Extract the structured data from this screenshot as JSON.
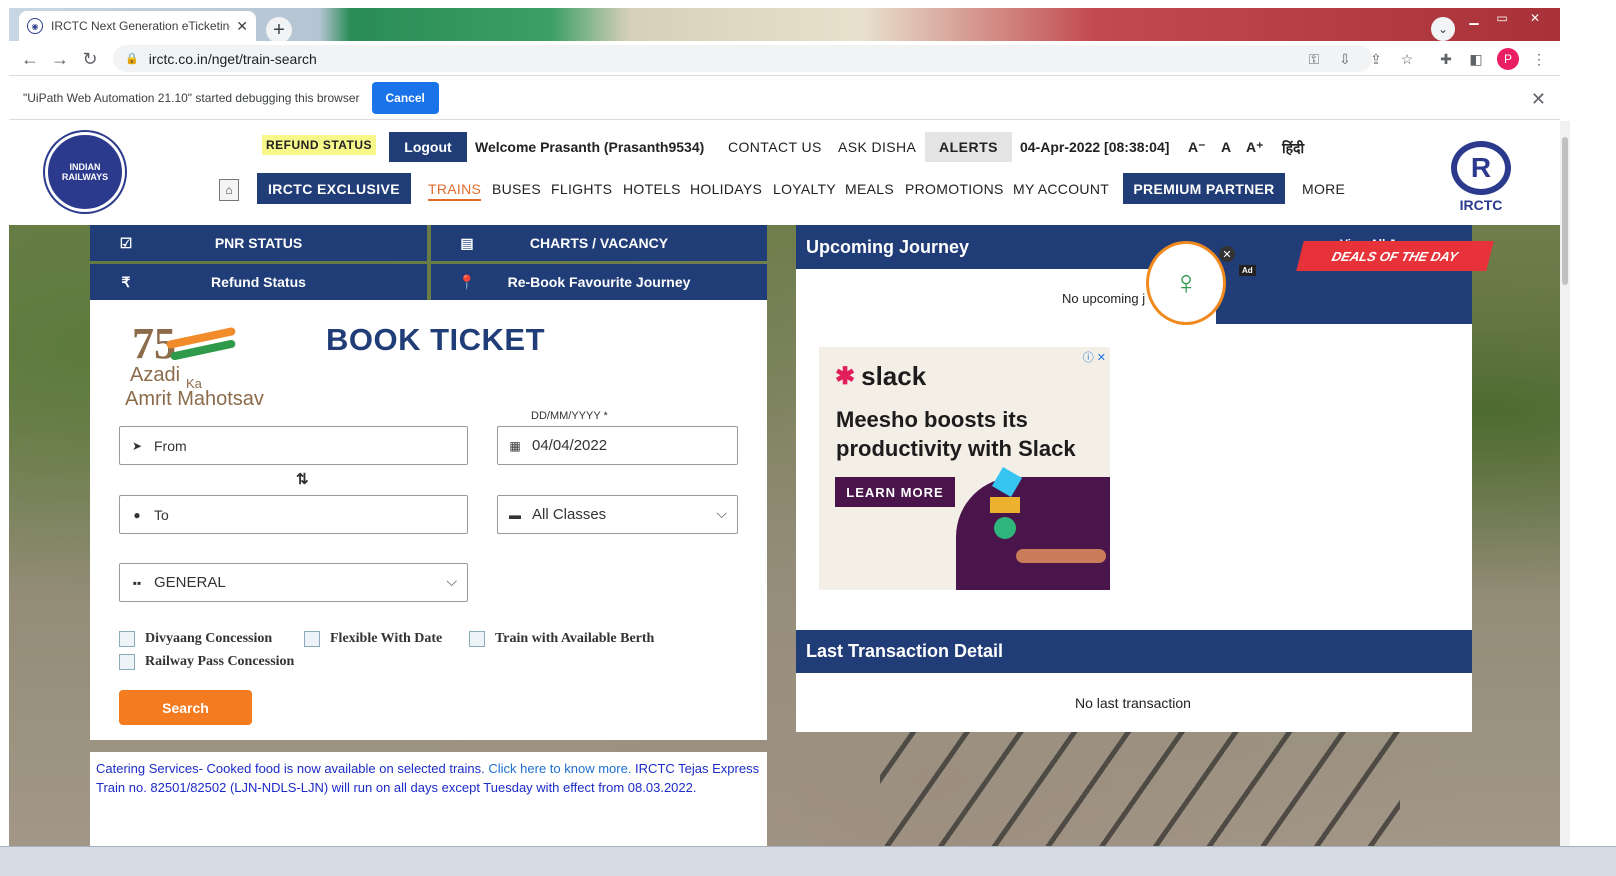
{
  "browser": {
    "tab_title": "IRCTC Next Generation eTicketing",
    "tab_close": "✕",
    "new_tab": "+",
    "url": "irctc.co.in/nget/train-search",
    "profile_initial": "P",
    "minimize": "▁",
    "maximize": "▭",
    "close": "✕"
  },
  "infobar": {
    "message": "\"UiPath Web Automation 21.10\" started debugging this browser",
    "cancel_label": "Cancel",
    "close": "✕"
  },
  "header": {
    "refund_status": "REFUND STATUS",
    "logout": "Logout",
    "welcome": "Welcome Prasanth (Prasanth9534)",
    "contact_us": "CONTACT US",
    "ask_disha": "ASK DISHA",
    "alerts": "ALERTS",
    "datetime": "04-Apr-2022 [08:38:04]",
    "font_small": "A⁻",
    "font_normal": "A",
    "font_large": "A⁺",
    "hindi": "हिंदी",
    "logo_text": "IRCTC",
    "emblem_text": "INDIAN RAILWAYS"
  },
  "mainnav": {
    "exclusive": "IRCTC EXCLUSIVE",
    "trains": "TRAINS",
    "buses": "BUSES",
    "flights": "FLIGHTS",
    "hotels": "HOTELS",
    "holidays": "HOLIDAYS",
    "loyalty": "LOYALTY",
    "meals": "MEALS",
    "promotions": "PROMOTIONS",
    "my_account": "MY ACCOUNT",
    "premium_partner": "PREMIUM PARTNER",
    "more": "MORE"
  },
  "quicktabs": {
    "pnr_status": "PNR STATUS",
    "charts_vacancy": "CHARTS / VACANCY",
    "refund_status": "Refund Status",
    "rebook": "Re-Book Favourite Journey"
  },
  "book": {
    "title": "BOOK TICKET",
    "amrit_75": "75",
    "amrit_azadi": "Azadi",
    "amrit_ka": "Ka",
    "amrit_mahotsav": "Amrit Mahotsav",
    "from_placeholder": "From",
    "to_placeholder": "To",
    "date_label": "DD/MM/YYYY *",
    "date_value": "04/04/2022",
    "class_value": "All Classes",
    "quota_value": "GENERAL",
    "swap_icon": "⇅",
    "checkboxes": {
      "divyaang": "Divyaang Concession",
      "flexible": "Flexible With Date",
      "available_berth": "Train with Available Berth",
      "railway_pass": "Railway Pass Concession"
    },
    "search": "Search"
  },
  "notice": {
    "text1": "Catering Services- Cooked food is now available on selected trains. ",
    "link": "Click here to know more.",
    "text2": " IRCTC Tejas Express Train no. 82501/82502 (LJN-NDLS-LJN) will run on all days except Tuesday with effect from 08.03.2022."
  },
  "journey": {
    "title": "Upcoming Journey",
    "view_all": "View All Journeys",
    "empty": "No upcoming j"
  },
  "deals": {
    "label": "DEALS OF THE DAY",
    "ad_tag": "Ad",
    "close": "✕"
  },
  "ad": {
    "choices": "ⓘ ✕",
    "brand": "slack",
    "headline": "Meesho boosts its productivity with Slack",
    "cta": "LEARN MORE"
  },
  "transaction": {
    "title": "Last Transaction Detail",
    "empty": "No last transaction"
  }
}
